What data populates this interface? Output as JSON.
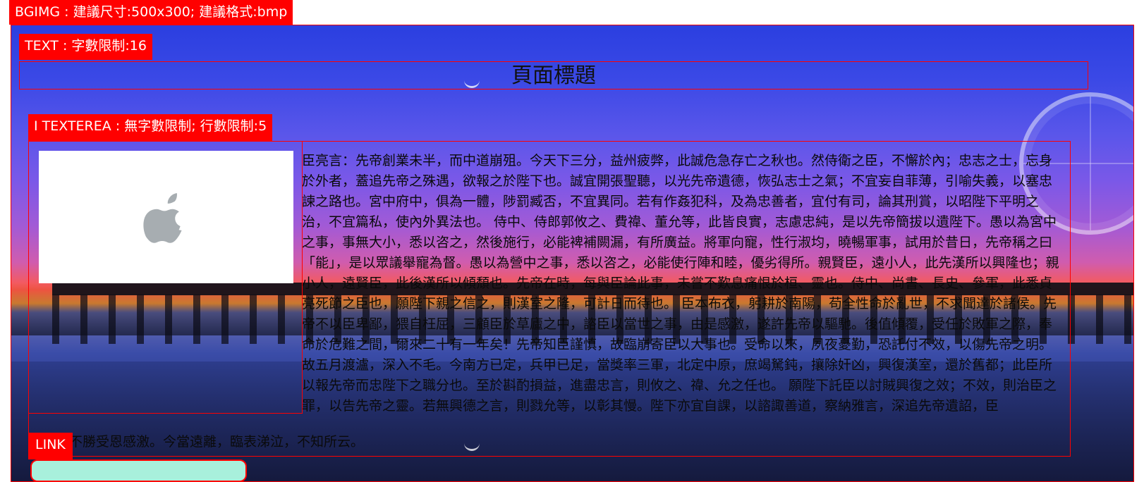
{
  "labels": {
    "bgimg": "BGIMG : 建議尺寸:500x300; 建議格式:bmp",
    "text": "TEXT : 字數限制:16",
    "textarea": "I TEXTEREA : 無字數限制; 行數限制:5",
    "link": "LINK"
  },
  "page": {
    "title": "頁面標題"
  },
  "article": {
    "body": "臣亮言：先帝創業未半，而中道崩殂。今天下三分，益州疲弊，此誠危急存亡之秋也。然侍衛之臣，不懈於內；忠志之士，忘身於外者，蓋追先帝之殊遇，欲報之於陛下也。誠宜開張聖聽，以光先帝遺德，恢弘志士之氣；不宜妄自菲薄，引喻失義，以塞忠諫之路也。宮中府中，俱為一體，陟罰臧否，不宜異同。若有作姦犯科，及為忠善者，宜付有司，論其刑賞，以昭陛下平明之治，不宜篇私，使內外異法也。 侍中、侍郎郭攸之、費禕、董允等，此皆良實，志慮忠純，是以先帝簡拔以遺陛下。愚以為宮中之事，事無大小，悉以咨之，然後施行，必能裨補闕漏，有所廣益。將軍向寵，性行淑均，曉暢軍事，試用於昔日，先帝稱之曰「能」，是以眾議舉寵為督。愚以為營中之事，悉以咨之，必能使行陣和睦，優劣得所。親賢臣，遠小人，此先漢所以興隆也；親小人，遠賢臣，此後漢所以傾頹也。先帝在時，每與臣論此事，未嘗不歎息痛恨於桓、靈也。侍中、尚書、長史、參軍，此悉貞亮死節之臣也，願陛下親之信之，則漢室之隆，可計日而待也。 臣本布衣，躬耕於南陽，苟全性命於亂世，不求聞達於諸侯。先帝不以臣卑鄙，猥自枉屈，三顧臣於草廬之中，諮臣以當世之事，由是感激，遂許先帝以驅馳。後值傾覆，受任於敗軍之際，奉命於危難之間，爾來二十有一年矣！先帝知臣謹慎，故臨崩寄臣以大事也。受命以來，夙夜憂勤，恐託付不效，以傷先帝之明。故五月渡瀘，深入不毛。今南方已定，兵甲已足，當獎率三軍，北定中原，庶竭駑鈍，攘除奸凶，興復漢室，還於舊都；此臣所以報先帝而忠陛下之職分也。至於斟酌損益，進盡忠言，則攸之、禕、允之任也。 願陛下託臣以討賊興復之效；不效，則治臣之罪，以告先帝之靈。若無興德之言，則戮允等，以彰其慢。陛下亦宜自課，以諮諏善道，察納雅言，深追先帝遺詔，臣",
    "tail": "不勝受恩感激。今當遠離，臨表涕泣，不知所云。"
  },
  "icons": {
    "placeholder_logo": "apple-icon"
  },
  "colors": {
    "accent_red": "#ff0000",
    "link_fill": "#a8f0dc",
    "apple_gray": "#a7adb1"
  }
}
